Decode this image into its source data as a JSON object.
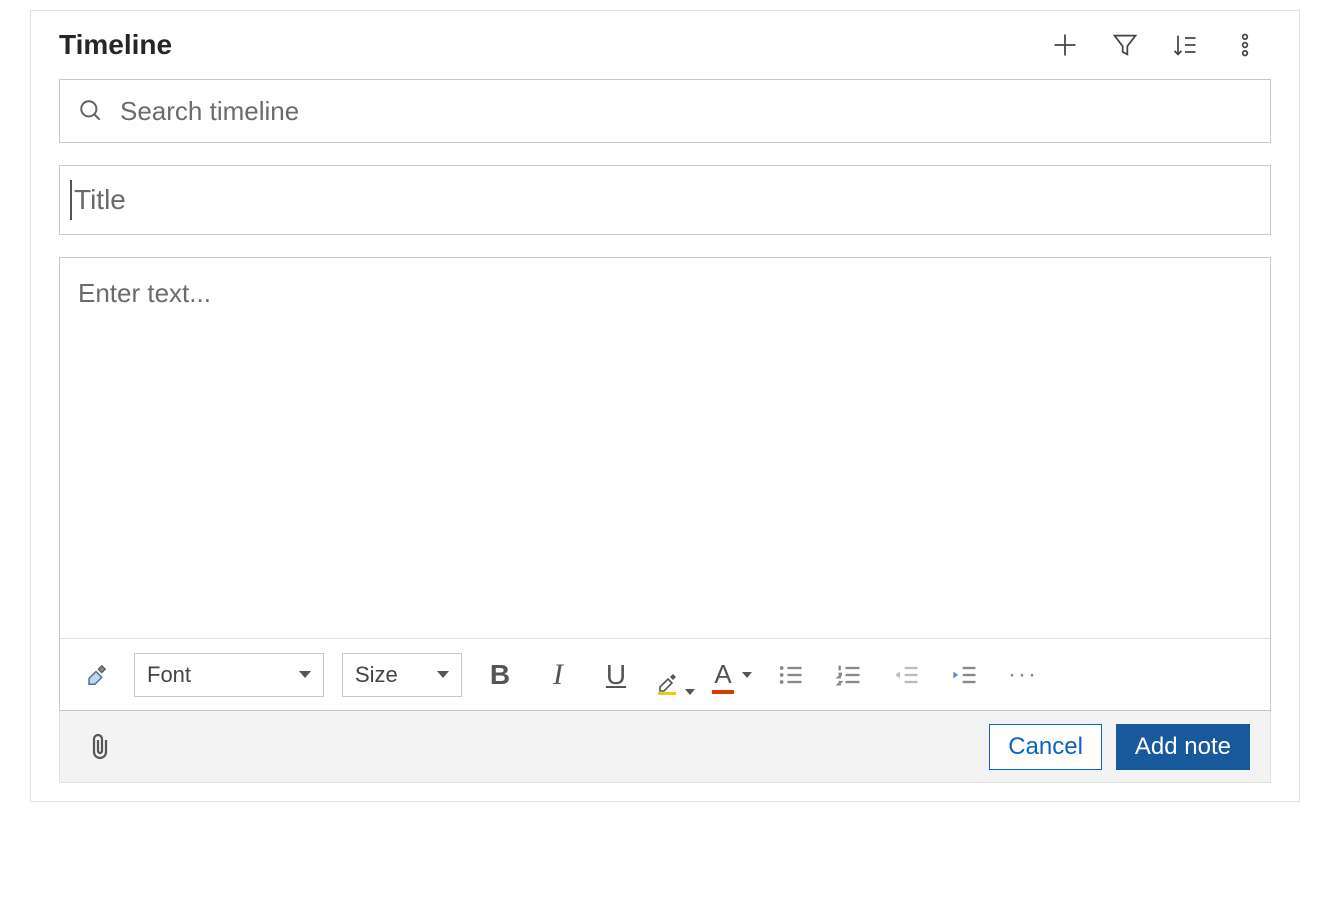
{
  "header": {
    "title": "Timeline",
    "actions": {
      "add": "add",
      "filter": "filter",
      "sort": "sort",
      "more": "more"
    }
  },
  "search": {
    "placeholder": "Search timeline",
    "value": ""
  },
  "note": {
    "title_placeholder": "Title",
    "title_value": "",
    "body_placeholder": "Enter text...",
    "body_value": ""
  },
  "toolbar": {
    "format_painter": "format-painter",
    "font_label": "Font",
    "size_label": "Size",
    "bold": "B",
    "italic": "I",
    "underline": "U",
    "highlight": "highlight",
    "font_color": "A",
    "bulleted_list": "bulleted-list",
    "numbered_list": "numbered-list",
    "outdent": "outdent",
    "indent": "indent",
    "more": "···"
  },
  "footer": {
    "attach": "attach",
    "cancel_label": "Cancel",
    "add_note_label": "Add note"
  }
}
